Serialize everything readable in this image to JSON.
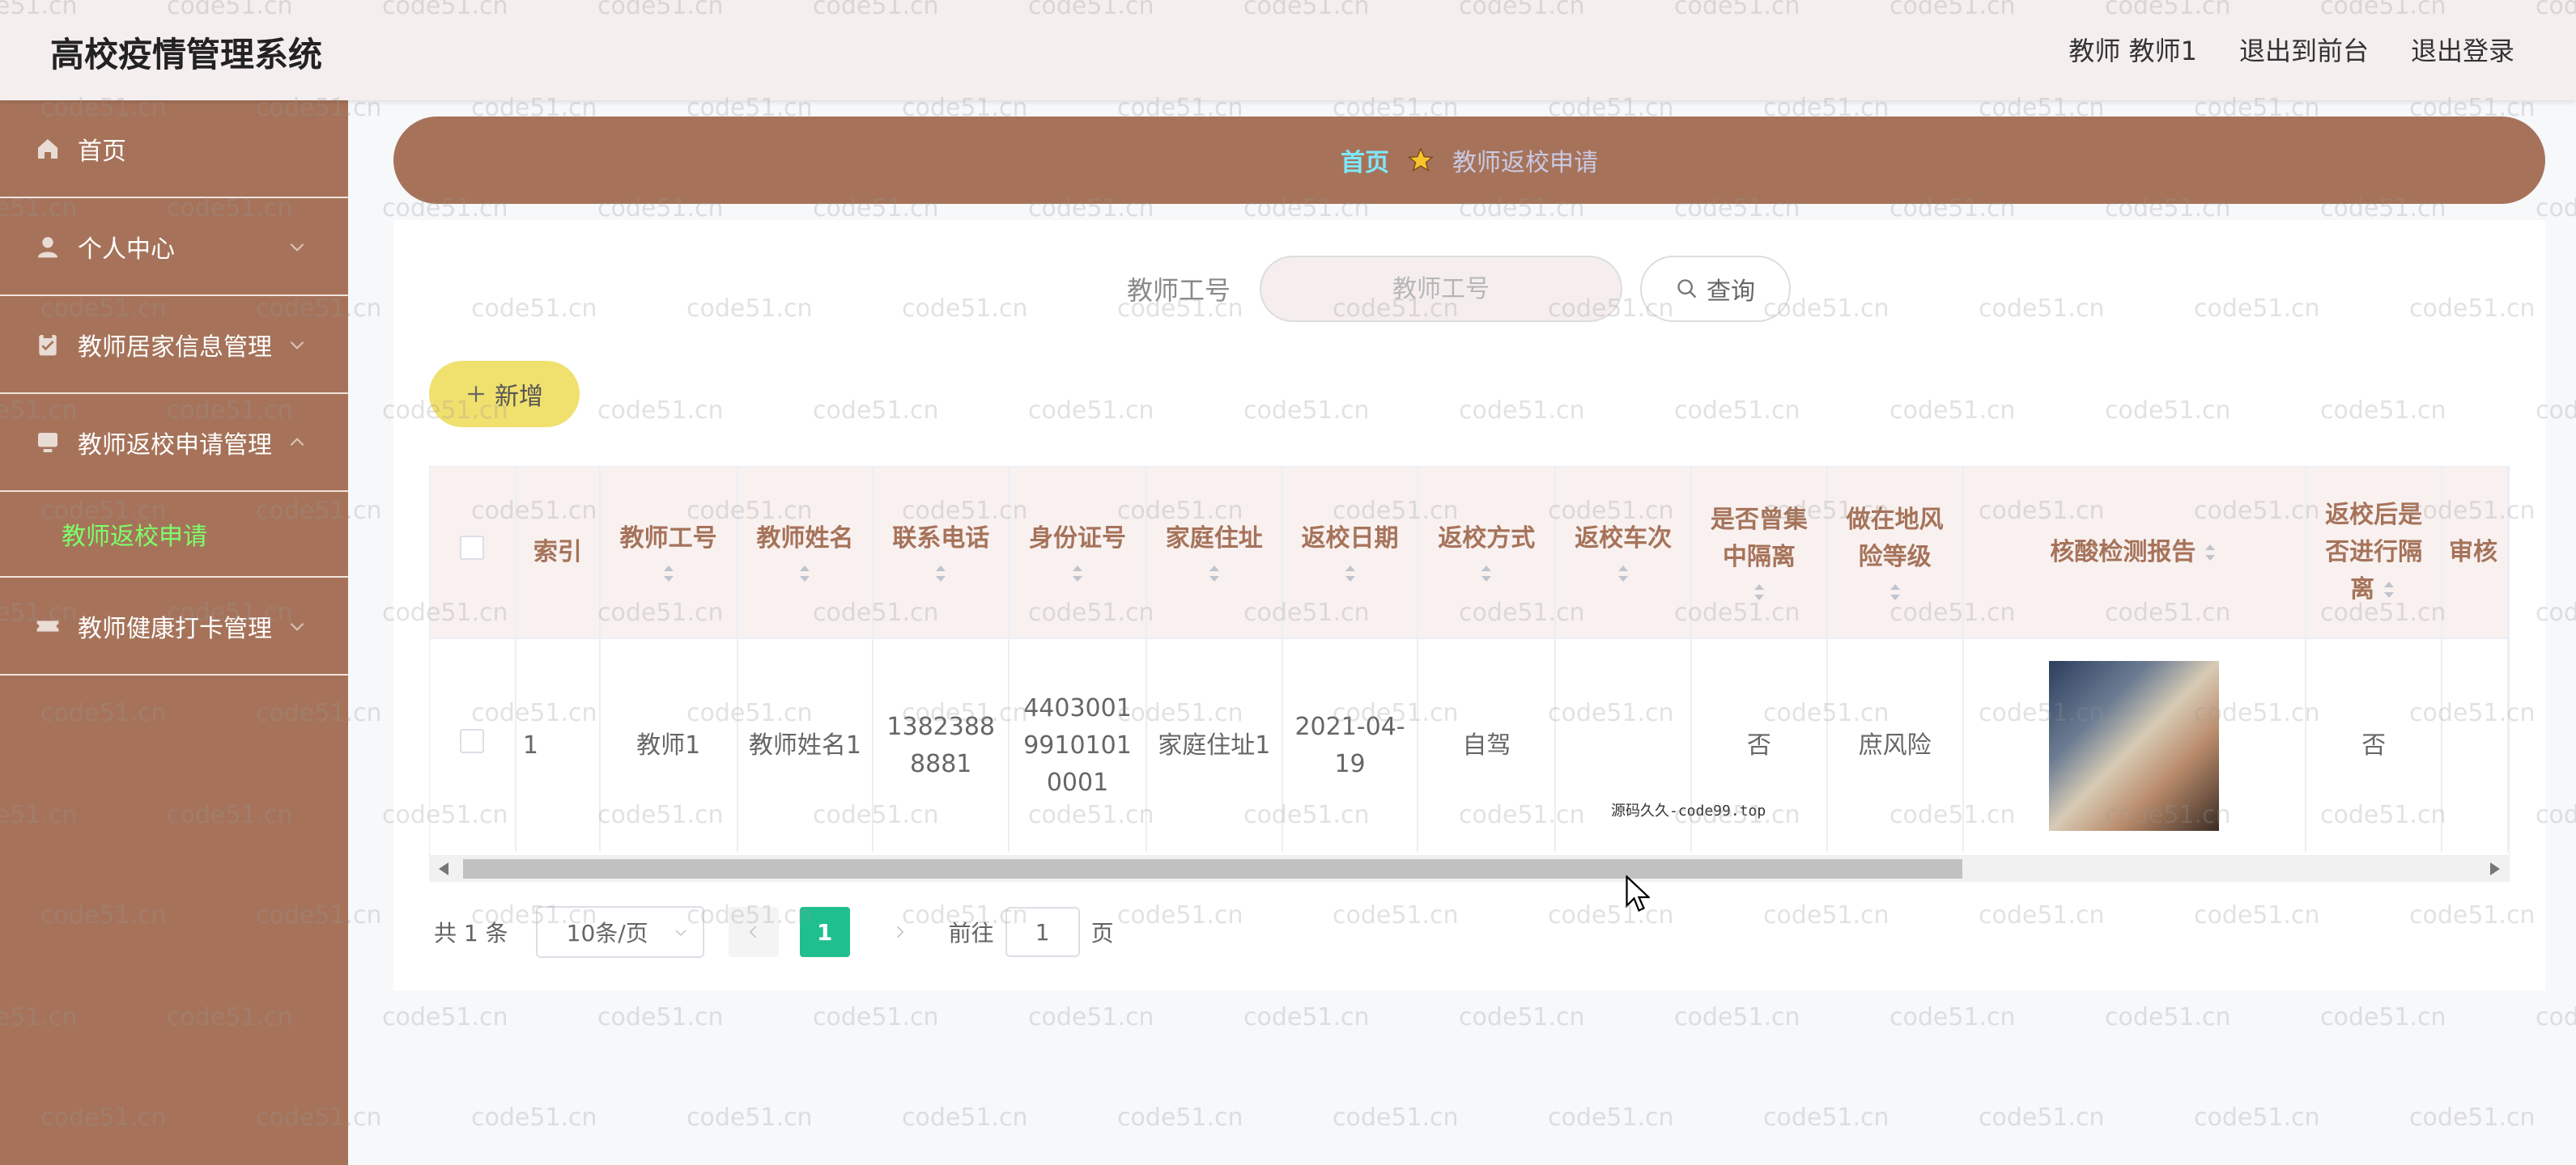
{
  "header": {
    "brand": "高校疫情管理系统",
    "user": "教师 教师1",
    "back_front": "退出到前台",
    "logout": "退出登录"
  },
  "sidebar": {
    "items": [
      {
        "label": "首页",
        "icon": "home-icon"
      },
      {
        "label": "个人中心",
        "icon": "user-icon"
      },
      {
        "label": "教师居家信息管理",
        "icon": "clipboard-icon"
      },
      {
        "label": "教师返校申请管理",
        "icon": "monitor-icon"
      },
      {
        "label": "教师健康打卡管理",
        "icon": "ticket-icon"
      }
    ],
    "submenu": "教师返校申请"
  },
  "breadcrumb": {
    "home": "首页",
    "current": "教师返校申请"
  },
  "search": {
    "label": "教师工号",
    "placeholder": "教师工号",
    "button": "查询"
  },
  "add_button": "新增",
  "table": {
    "headers": [
      "索引",
      "教师工号",
      "教师姓名",
      "联系电话",
      "身份证号",
      "家庭住址",
      "返校日期",
      "返校方式",
      "返校车次",
      "是否曾集中隔离",
      "做在地风险等级",
      "核酸检测报告",
      "返校后是否进行隔离",
      "审核"
    ],
    "row": {
      "index": "1",
      "teacher_id": "教师1",
      "name": "教师姓名1",
      "phone": "13823888881",
      "id_card": "440300199101010001",
      "address": "家庭住址1",
      "date": "2021-04-19",
      "method": "自驾",
      "train": "",
      "isolated": "否",
      "risk": "庶风险",
      "report_image": "nucleic-test-report-photo",
      "isolate_after": "否"
    }
  },
  "pagination": {
    "total": "共 1 条",
    "page_size": "10条/页",
    "current": "1",
    "goto_label": "前往",
    "goto_value": "1",
    "page_suffix": "页"
  },
  "note": "源码久久-code99.top",
  "watermark": "code51.cn",
  "colors": {
    "sidebar": "#a6735a",
    "header": "#f5eeee",
    "accent_green": "#1fbf8f",
    "add_button": "#f0e06e",
    "submenu_active": "#7cff6a"
  }
}
